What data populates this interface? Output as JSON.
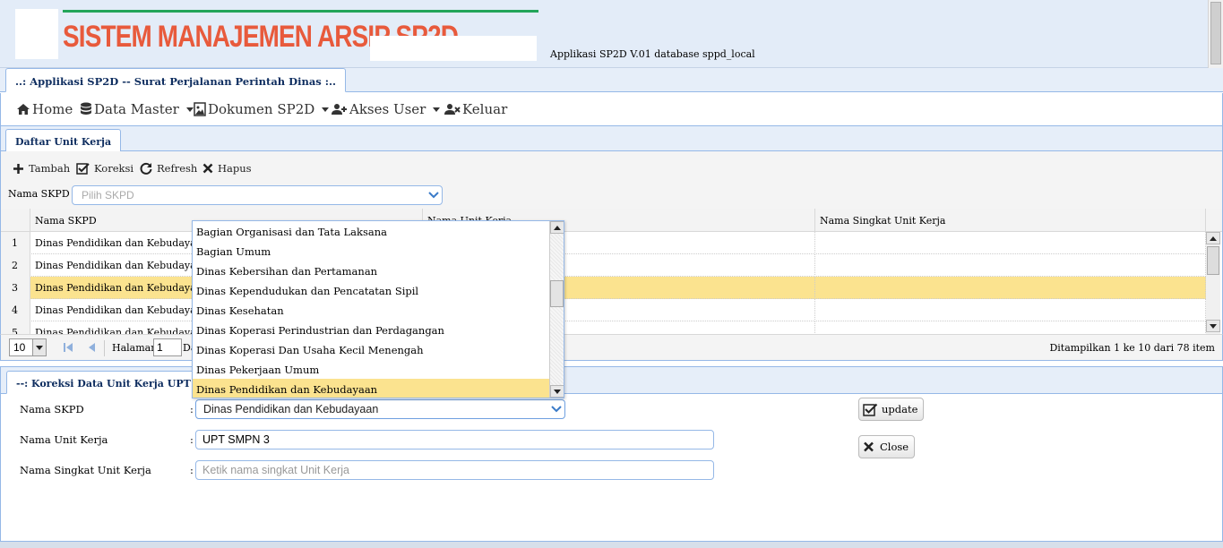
{
  "header": {
    "title": "SISTEM MANAJEMEN ARSIP SP2D",
    "version": "Applikasi SP2D V.01 database sppd_local",
    "brand_color": "#e85a3c"
  },
  "main_tab": {
    "label": "..: Applikasi SP2D -- Surat Perjalanan Perintah Dinas :.."
  },
  "menu": {
    "home": "Home",
    "data_master": "Data Master",
    "dokumen": "Dokumen SP2D",
    "akses_user": "Akses User",
    "keluar": "Keluar"
  },
  "panel_tab": {
    "label": "Daftar Unit Kerja"
  },
  "toolbar": {
    "tambah": "Tambah",
    "koreksi": "Koreksi",
    "refresh": "Refresh",
    "hapus": "Hapus"
  },
  "filter": {
    "label": "Nama SKPD :",
    "placeholder": "Pilih SKPD"
  },
  "grid": {
    "columns": [
      "Nama SKPD",
      "Nama Unit Kerja",
      "Nama Singkat Unit Kerja"
    ],
    "rows": [
      {
        "no": "1",
        "skpd": "Dinas Pendidikan dan Kebudayaan",
        "unit": "",
        "singkat": ""
      },
      {
        "no": "2",
        "skpd": "Dinas Pendidikan dan Kebudayaan",
        "unit": "",
        "singkat": ""
      },
      {
        "no": "3",
        "skpd": "Dinas Pendidikan dan Kebudayaan",
        "unit": "",
        "singkat": ""
      },
      {
        "no": "4",
        "skpd": "Dinas Pendidikan dan Kebudayaan",
        "unit": "",
        "singkat": ""
      },
      {
        "no": "5",
        "skpd": "Dinas Pendidikan dan Kebudayaan",
        "unit": "",
        "singkat": ""
      }
    ],
    "selected_row": 3
  },
  "pager": {
    "page_size": "10",
    "halaman_label": "Halaman",
    "page": "1",
    "dari_label": "Da",
    "summary": "Ditampilkan 1 ke 10 dari 78 item"
  },
  "form": {
    "tab_label": "--: Koreksi Data Unit Kerja UPT SMP",
    "skpd_label": "Nama SKPD",
    "skpd_value": "Dinas Pendidikan dan Kebudayaan",
    "unit_label": "Nama Unit Kerja",
    "unit_value": "UPT SMPN 3",
    "singkat_label": "Nama Singkat Unit Kerja",
    "singkat_placeholder": "Ketik  nama singkat Unit Kerja",
    "colon": ":",
    "update_btn": "update",
    "close_btn": "Close"
  },
  "dropdown": {
    "items": [
      "Bagian Organisasi dan Tata Laksana",
      "Bagian Umum",
      "Dinas Kebersihan dan Pertamanan",
      "Dinas Kependudukan dan Pencatatan Sipil",
      "Dinas Kesehatan",
      "Dinas Koperasi Perindustrian dan Perdagangan",
      "Dinas Koperasi Dan Usaha Kecil Menengah",
      "Dinas Pekerjaan Umum",
      "Dinas Pendidikan dan Kebudayaan"
    ],
    "selected_index": 8
  }
}
